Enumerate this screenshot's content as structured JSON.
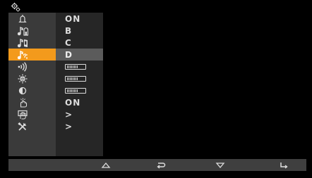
{
  "header": {
    "icon": "settings-gear-icon"
  },
  "menu": {
    "selected_index": 3,
    "items": [
      {
        "id": "ring",
        "icon": "bell-icon",
        "value": "ON"
      },
      {
        "id": "door-melody",
        "icon": "melody-door-icon",
        "value": "B"
      },
      {
        "id": "intercom-melody",
        "icon": "melody-intercom-icon",
        "value": "C"
      },
      {
        "id": "floor-melody",
        "icon": "melody-floor-icon",
        "value": "D"
      },
      {
        "id": "volume",
        "icon": "volume-icon",
        "level": 0.6
      },
      {
        "id": "brightness",
        "icon": "brightness-icon",
        "level": 0.6
      },
      {
        "id": "contrast",
        "icon": "contrast-icon",
        "level": 0.6
      },
      {
        "id": "touch-sound",
        "icon": "touch-icon",
        "value": "ON"
      },
      {
        "id": "screen-clean",
        "icon": "hand-clean-icon",
        "value": ">"
      },
      {
        "id": "tools",
        "icon": "tools-icon",
        "value": ">"
      }
    ]
  },
  "bottom_bar": {
    "buttons": [
      {
        "id": "up",
        "icon": "triangle-up-icon"
      },
      {
        "id": "back",
        "icon": "back-arrow-icon"
      },
      {
        "id": "down",
        "icon": "triangle-down-icon"
      },
      {
        "id": "enter",
        "icon": "enter-arrow-icon"
      }
    ]
  },
  "colors": {
    "background": "#000000",
    "menu_bg": "#3a3a3a",
    "value_bg": "#262626",
    "accent": "#f39a1c",
    "selected_value_bg": "#5b5b5b",
    "bottom_bar_bg": "#3f3f3f",
    "text": "#dcdcdc"
  }
}
